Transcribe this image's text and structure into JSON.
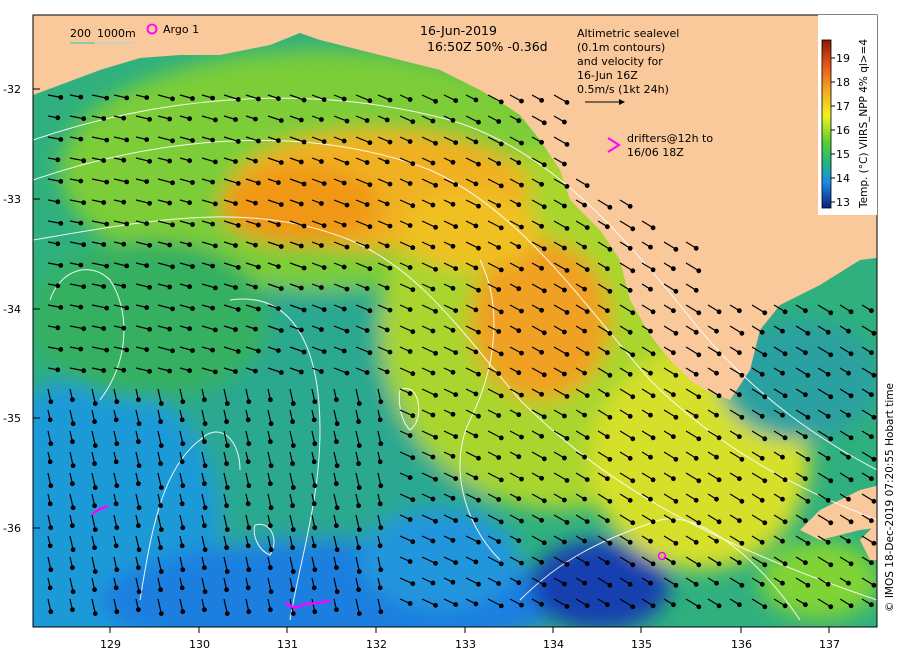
{
  "header": {
    "date": "16-Jun-2019",
    "time_line": "16:50Z  50% -0.36d"
  },
  "legend_depth": {
    "label_a": "200",
    "label_b": "1000m"
  },
  "legend_argo": {
    "label": "Argo 1"
  },
  "altimetry_note": {
    "lines": [
      "Altimetric sealevel",
      "(0.1m contours)",
      "and velocity for",
      "16-Jun 16Z",
      "0.5m/s (1kt 24h)"
    ]
  },
  "drifters_note": {
    "lines": [
      "drifters@12h to",
      "16/06 18Z"
    ]
  },
  "colorbar": {
    "title": "Temp. (°C) VIIRS_NPP 4% ql>=4",
    "ticks": [
      "19",
      "18",
      "17",
      "16",
      "15",
      "14",
      "13"
    ]
  },
  "axes": {
    "y_ticks": [
      "-32",
      "-33",
      "-34",
      "-35",
      "-36"
    ],
    "x_ticks": [
      "129",
      "130",
      "131",
      "132",
      "133",
      "134",
      "135",
      "136",
      "137"
    ]
  },
  "credit": "© IMOS 18-Dec-2019 07:20:55 Hobart time",
  "colors": {
    "land": "#f9c89b",
    "warm": "#f0a020",
    "mid": "#7fd336",
    "cool": "#33b57e",
    "cold": "#1e8fe0",
    "drifter": "#ff00ff",
    "contour": "#ffffff"
  }
}
